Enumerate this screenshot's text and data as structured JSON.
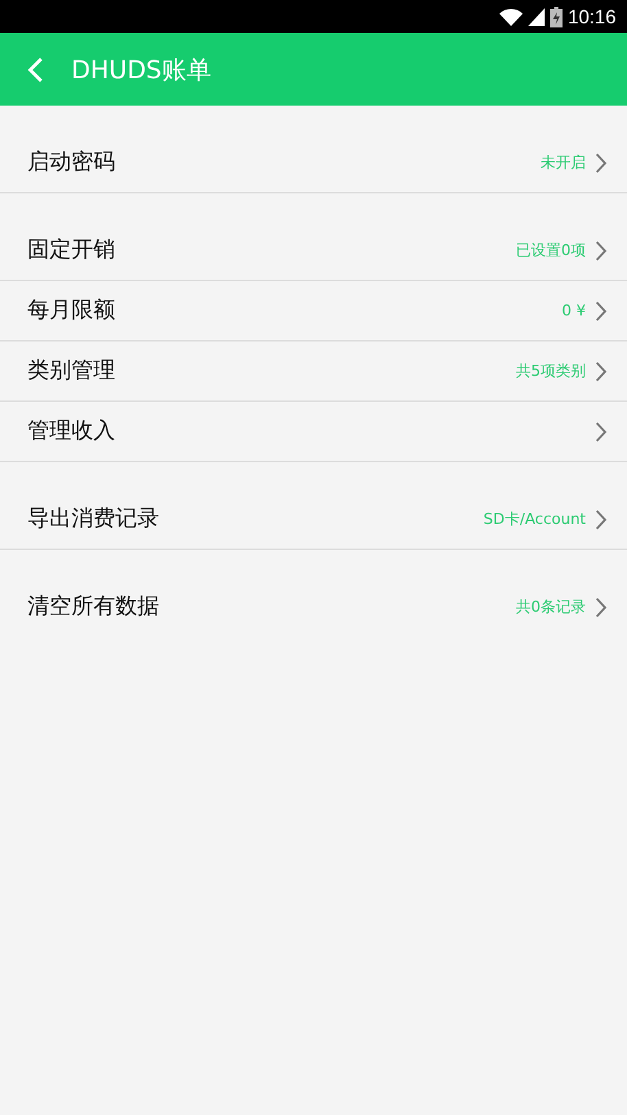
{
  "status_bar": {
    "time": "10:16"
  },
  "header": {
    "title": "DHUDS账单"
  },
  "groups": [
    {
      "rows": [
        {
          "label": "启动密码",
          "value": "未开启"
        }
      ]
    },
    {
      "rows": [
        {
          "label": "固定开销",
          "value": "已设置0项"
        },
        {
          "label": "每月限额",
          "value": "0 ¥"
        },
        {
          "label": "类别管理",
          "value": "共5项类别"
        },
        {
          "label": "管理收入"
        }
      ]
    },
    {
      "rows": [
        {
          "label": "导出消费记录",
          "value": "SD卡/Account"
        }
      ]
    },
    {
      "rows": [
        {
          "label": "清空所有数据",
          "value": "共0条记录"
        }
      ]
    }
  ]
}
